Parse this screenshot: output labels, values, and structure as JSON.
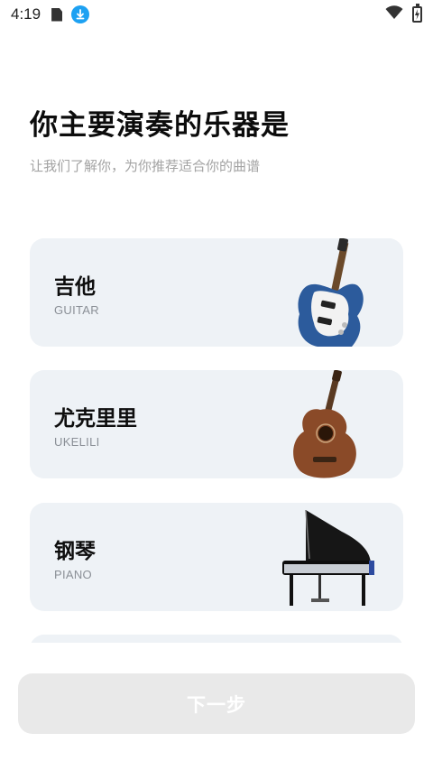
{
  "status_bar": {
    "time": "4:19",
    "icons": [
      "sim-icon",
      "download-icon",
      "wifi-icon",
      "battery-charging-icon"
    ]
  },
  "header": {
    "title": "你主要演奏的乐器是",
    "subtitle": "让我们了解你，为你推荐适合你的曲谱"
  },
  "instruments": [
    {
      "name": "吉他",
      "en": "GUITAR",
      "icon": "guitar-image"
    },
    {
      "name": "尤克里里",
      "en": "UKELILI",
      "icon": "ukulele-image"
    },
    {
      "name": "钢琴",
      "en": "PIANO",
      "icon": "piano-image"
    }
  ],
  "footer": {
    "next_label": "下一步"
  },
  "colors": {
    "card_bg": "#eef2f6",
    "button_disabled_bg": "#e9e9e9",
    "subtitle": "#a3a3a3",
    "download_badge": "#1da1f2"
  }
}
